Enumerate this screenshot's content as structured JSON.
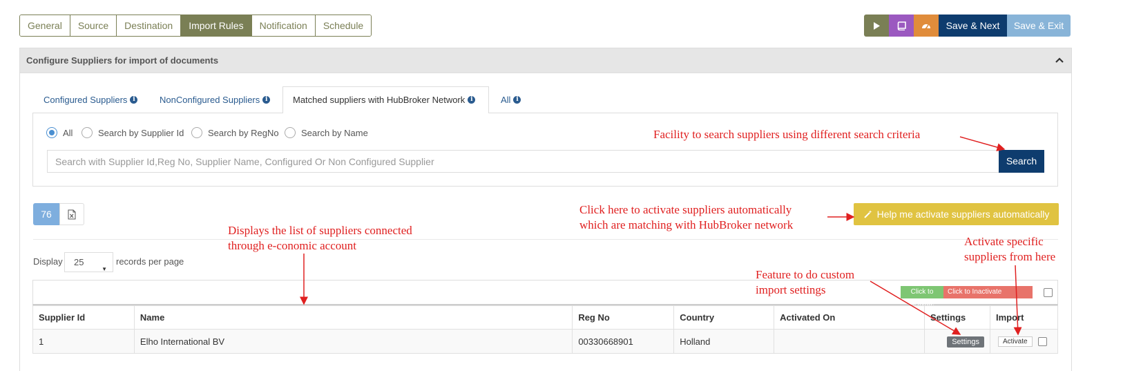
{
  "top_tabs": [
    "General",
    "Source",
    "Destination",
    "Import Rules",
    "Notification",
    "Schedule"
  ],
  "active_tab": "Import Rules",
  "actions": {
    "save_next": "Save & Next",
    "save_exit": "Save & Exit"
  },
  "panel": {
    "title": "Configure Suppliers for import of documents"
  },
  "inner_tabs": {
    "configured": "Configured Suppliers",
    "nonconfigured": "NonConfigured Suppliers",
    "matched": "Matched suppliers with HubBroker Network",
    "all": "All"
  },
  "radios": {
    "all": "All",
    "by_id": "Search by Supplier Id",
    "by_regno": "Search by RegNo",
    "by_name": "Search by Name"
  },
  "search": {
    "placeholder": "Search with Supplier Id,Reg No, Supplier Name, Configured Or Non Configured Supplier",
    "button": "Search"
  },
  "count": "76",
  "help_button": "Help me activate suppliers automatically",
  "paging": {
    "display": "Display",
    "page_size": "25",
    "suffix": "records per page"
  },
  "bulk": {
    "activate": "Click to Activate",
    "inactivate": "Click to Inactivate"
  },
  "table": {
    "headers": [
      "Supplier Id",
      "Name",
      "Reg No",
      "Country",
      "Activated On",
      "Settings",
      "Import"
    ],
    "rows": [
      {
        "id": "1",
        "name": "Elho International BV",
        "regno": "00330668901",
        "country": "Holland",
        "activated_on": "",
        "settings_label": "Settings",
        "import_label": "Activate"
      }
    ]
  },
  "annotations": {
    "search_facility": "Facility to search suppliers using different search criteria",
    "auto_activate_1": "Click here to activate suppliers automatically",
    "auto_activate_2": "which are matching with HubBroker network",
    "list_1": "Displays the list of suppliers connected",
    "list_2": "through e-conomic account",
    "custom_1": "Feature to do custom",
    "custom_2": "import settings",
    "specific_1": "Activate specific",
    "specific_2": "suppliers from here"
  },
  "colors": {
    "olive": "#7a7f55",
    "navy": "#0e3c6e",
    "annotation": "#e02020"
  }
}
